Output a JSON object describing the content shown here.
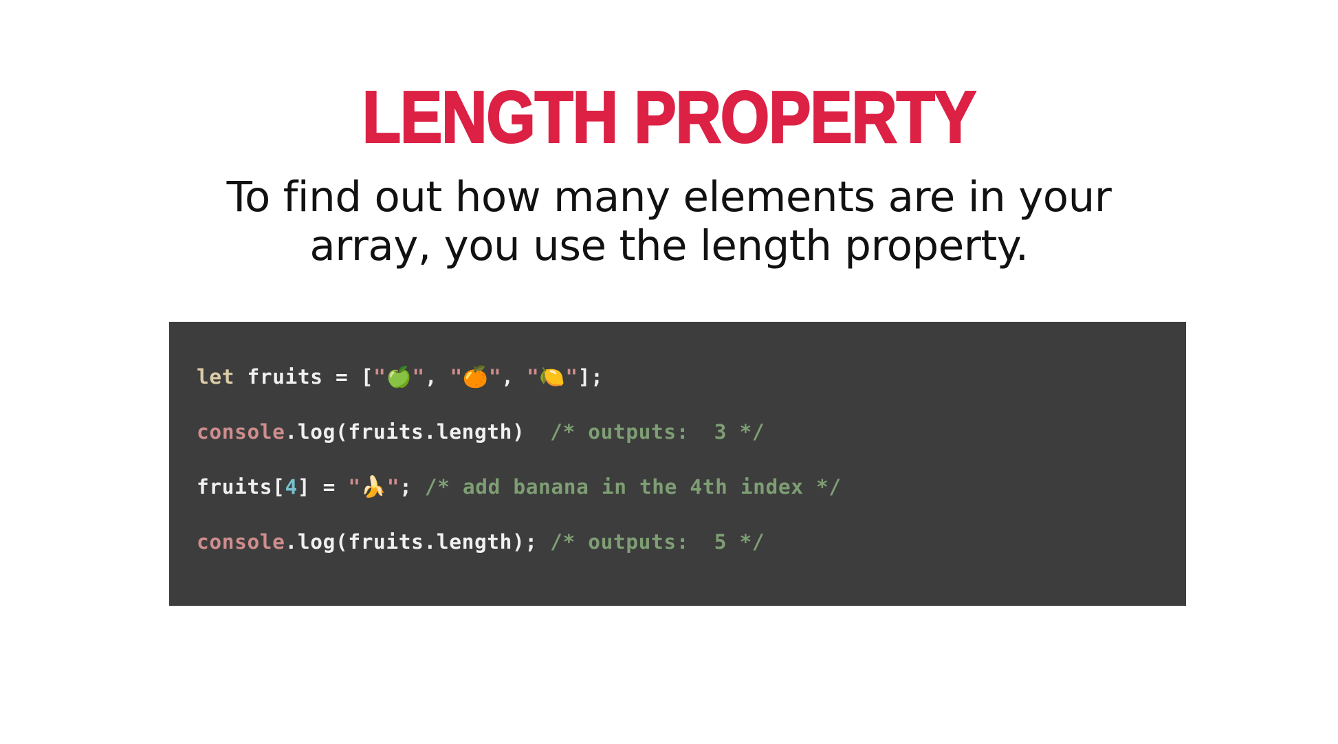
{
  "slide": {
    "background_color": "#ffffff",
    "title": "LENGTH PROPERTY",
    "title_color": "#DC2145",
    "body": {
      "line1": "To find out how many elements are in your",
      "line2": "array, you use the length property.",
      "color": "#111111"
    }
  },
  "code_block": {
    "background_color": "#3D3D3D",
    "colors": {
      "keyword": "#DBCCA8",
      "plain": "#F0F0F0",
      "object": "#CF8D8D",
      "string": "#CF8D8D",
      "number": "#79C0CF",
      "comment": "#7E9E74"
    },
    "lines": [
      {
        "id": "line-1",
        "plain_text": "let fruits = [\"🍏\", \"🍊\", \"🍋\"];",
        "tokens": {
          "keyword": "let",
          "space1": " ",
          "var": "fruits",
          "assign": " = [",
          "q1": "\"",
          "emoji1": "🍏",
          "q2": "\"",
          "comma1": ", ",
          "q3": "\"",
          "emoji2": "🍊",
          "q4": "\"",
          "comma2": ", ",
          "q5": "\"",
          "emoji3": "🍋",
          "q6": "\"",
          "end": "];"
        }
      },
      {
        "id": "line-2",
        "plain_text": "console.log(fruits.length)  /* outputs:  3 */",
        "tokens": {
          "object": "console",
          "call": ".log(fruits.length)",
          "gap": "  ",
          "comment": "/* outputs:  3 */"
        }
      },
      {
        "id": "line-3",
        "plain_text": "fruits[4] = \"🍌\"; /* add banana in the 4th index */",
        "tokens": {
          "var": "fruits[",
          "index": "4",
          "close": "] = ",
          "q1": "\"",
          "emoji": "🍌",
          "q2": "\"",
          "semi": "; ",
          "comment": "/* add banana in the 4th index */"
        }
      },
      {
        "id": "line-4",
        "plain_text": "console.log(fruits.length); /* outputs:  5 */",
        "tokens": {
          "object": "console",
          "call": ".log(fruits.length);",
          "gap": " ",
          "comment": "/* outputs:  5 */"
        }
      }
    ]
  }
}
